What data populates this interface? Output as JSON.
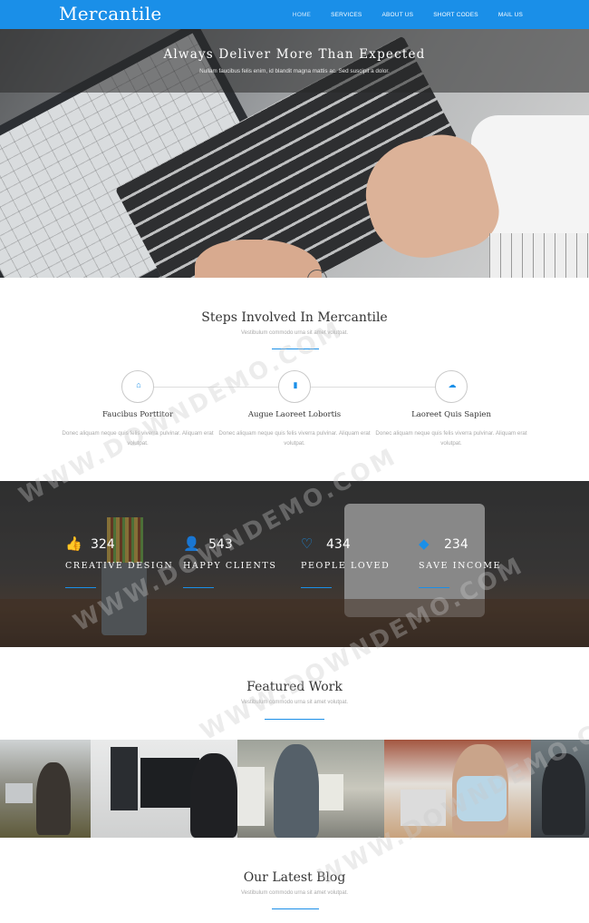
{
  "header": {
    "logo": "Mercantile",
    "nav": [
      "HOME",
      "SERVICES",
      "ABOUT US",
      "SHORT CODES",
      "MAIL US"
    ]
  },
  "hero": {
    "title": "Always Deliver More Than Expected",
    "subtitle": "Nullam faucibus felis enim, id blandit magna mattis ac. Sed suscipit a dolor."
  },
  "steps": {
    "title": "Steps Involved In Mercantile",
    "subtitle": "Vestibulum commodo urna sit amet volutpat.",
    "items": [
      {
        "icon": "home-icon",
        "glyph": "⌂",
        "name": "Faucibus Porttitor",
        "desc": "Donec aliquam neque quis felis viverra pulvinar. Aliquam erat volutpat."
      },
      {
        "icon": "bar-chart-icon",
        "glyph": "▮",
        "name": "Augue Laoreet Lobortis",
        "desc": "Donec aliquam neque quis felis viverra pulvinar. Aliquam erat volutpat."
      },
      {
        "icon": "cloud-upload-icon",
        "glyph": "☁",
        "name": "Laoreet Quis Sapien",
        "desc": "Donec aliquam neque quis felis viverra pulvinar. Aliquam erat volutpat."
      }
    ]
  },
  "stats": [
    {
      "icon": "thumbs-up-icon",
      "glyph": "👍",
      "number": "324",
      "label": "CREATIVE DESIGN"
    },
    {
      "icon": "user-icon",
      "glyph": "👤",
      "number": "543",
      "label": "HAPPY CLIENTS"
    },
    {
      "icon": "heart-icon",
      "glyph": "♡",
      "number": "434",
      "label": "PEOPLE LOVED"
    },
    {
      "icon": "money-icon",
      "glyph": "◆",
      "number": "234",
      "label": "SAVE INCOME"
    }
  ],
  "featured": {
    "title": "Featured Work",
    "subtitle": "Vestibulum commodo urna sit amet volutpat."
  },
  "blog": {
    "title": "Our Latest Blog",
    "subtitle": "Vestibulum commodo urna sit amet volutpat."
  },
  "watermark": "WWW.DOWNDEMO.COM",
  "colors": {
    "accent": "#1a8fe8"
  }
}
